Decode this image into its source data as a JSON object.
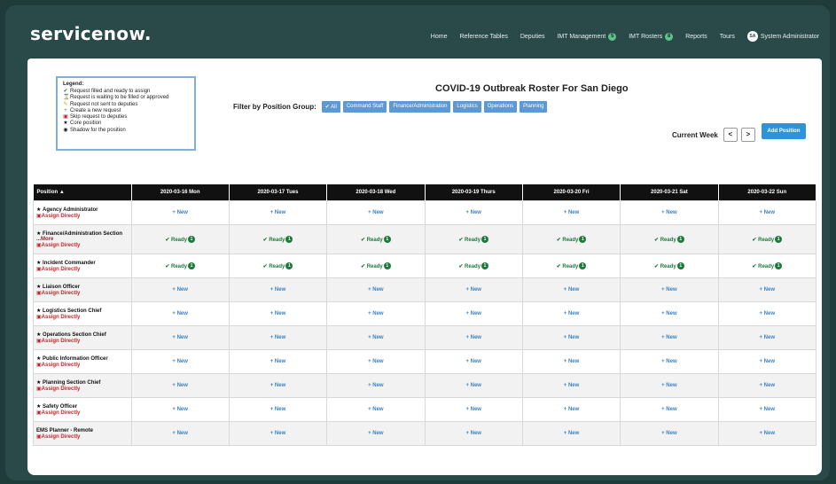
{
  "app": {
    "logo": "servicenow."
  },
  "nav": {
    "items": [
      {
        "label": "Home"
      },
      {
        "label": "Reference Tables"
      },
      {
        "label": "Deputies"
      },
      {
        "label": "IMT Management",
        "badge": "5"
      },
      {
        "label": "IMT Rosters",
        "badge": "8"
      },
      {
        "label": "Reports"
      },
      {
        "label": "Tours"
      }
    ],
    "user": {
      "initials": "SA",
      "name": "System Administrator"
    }
  },
  "legend": {
    "title": "Legend:",
    "items": [
      {
        "icon": "check-icon",
        "text": "Request filled and ready to assign",
        "color": "#1e7a3c"
      },
      {
        "icon": "hourglass-icon",
        "text": "Request is waiting to be filled or approved",
        "color": "#333333"
      },
      {
        "icon": "pencil-icon",
        "text": "Request not sent to deputies",
        "color": "#d9a300"
      },
      {
        "icon": "plus-icon",
        "text": "Create a new request",
        "color": "#3b82c4"
      },
      {
        "icon": "calendar-icon",
        "text": "Skip request to deputies",
        "color": "#c0272d"
      },
      {
        "icon": "star-icon",
        "text": "Core position",
        "color": "#111111"
      },
      {
        "icon": "user-circle-icon",
        "text": "Shadow for the position",
        "color": "#111111"
      }
    ]
  },
  "roster": {
    "title": "COVID-19 Outbreak Roster For San Diego",
    "filter_label": "Filter by Position Group:",
    "filters": [
      "✔ All",
      "Command Staff",
      "Finance/Administration",
      "Logistics",
      "Operations",
      "Planning"
    ],
    "current_week_label": "Current Week",
    "prev_symbol": "<",
    "next_symbol": ">",
    "add_position_label": "Add Position"
  },
  "table": {
    "position_header": "Position",
    "sort_symbol": "▲",
    "days": [
      "2020-03-16 Mon",
      "2020-03-17 Tues",
      "2020-03-18 Wed",
      "2020-03-19 Thurs",
      "2020-03-20 Fri",
      "2020-03-21 Sat",
      "2020-03-22 Sun"
    ],
    "new_label": "+ New",
    "ready_label": "✔ Ready",
    "ready_count": "1",
    "assign_label": "Assign Directly",
    "more_label": "...More",
    "rows": [
      {
        "name": "Agency Administrator",
        "core": true,
        "assign": true,
        "more": false,
        "status": "new"
      },
      {
        "name": "Finance/Administration Section",
        "core": true,
        "assign": true,
        "more": true,
        "status": "ready"
      },
      {
        "name": "Incident Commander",
        "core": true,
        "assign": true,
        "more": false,
        "status": "ready"
      },
      {
        "name": "Liaison Officer",
        "core": true,
        "assign": true,
        "more": false,
        "status": "new"
      },
      {
        "name": "Logistics Section Chief",
        "core": true,
        "assign": true,
        "more": false,
        "status": "new"
      },
      {
        "name": "Operations Section Chief",
        "core": true,
        "assign": true,
        "more": false,
        "status": "new"
      },
      {
        "name": "Public Information Officer",
        "core": true,
        "assign": true,
        "more": false,
        "status": "new"
      },
      {
        "name": "Planning Section Chief",
        "core": true,
        "assign": true,
        "more": false,
        "status": "new"
      },
      {
        "name": "Safety Officer",
        "core": true,
        "assign": true,
        "more": false,
        "status": "new"
      },
      {
        "name": "EMS Planner - Remote",
        "core": false,
        "assign": true,
        "more": false,
        "status": "new"
      }
    ]
  }
}
